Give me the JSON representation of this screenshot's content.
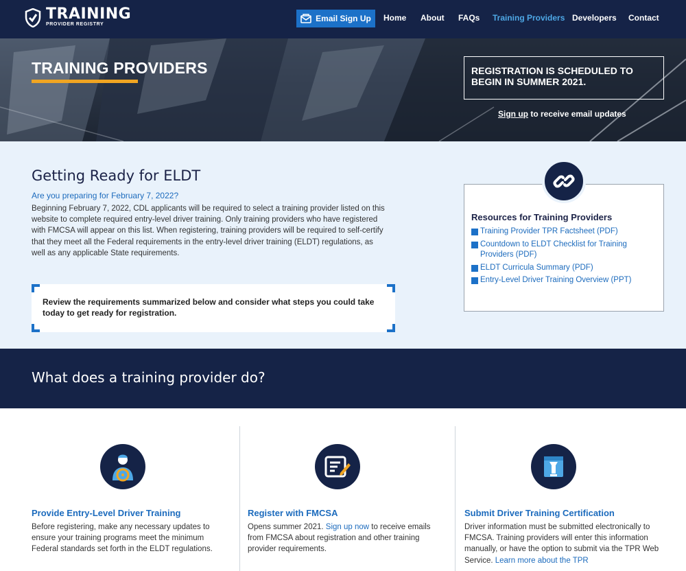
{
  "nav": {
    "logo_main": "TRAINING",
    "logo_sub": "PROVIDER REGISTRY",
    "email_button": "Email Sign Up",
    "links": [
      "Home",
      "About",
      "FAQs",
      "Training Providers",
      "Developers",
      "Contact"
    ],
    "active": "Training Providers",
    "colors": {
      "bg": "#152347",
      "active": "#4ea8e6",
      "button": "#1c71c8"
    }
  },
  "hero": {
    "title": "TRAINING PROVIDERS",
    "registration_notice": "REGISTRATION IS SCHEDULED TO BEGIN IN SUMMER 2021.",
    "signup_link": "Sign up",
    "signup_rest": " to receive email updates",
    "accent_color": "#f0a522"
  },
  "ready": {
    "heading": "Getting Ready for ELDT",
    "subheading": "Are you preparing for February 7, 2022?",
    "body": "Beginning February 7, 2022, CDL applicants will be required to select a training provider listed on this website to complete required entry-level driver training. Only training providers who have registered with FMCSA will appear on this list. When registering, training providers will be required to self-certify that they meet all the Federal requirements in the entry-level driver training (ELDT) regulations, as well as any applicable State requirements.",
    "callout": "Review the requirements summarized below and consider what steps you could take today to get ready for registration."
  },
  "resources": {
    "icon": "link-icon",
    "title": "Resources for Training Providers",
    "items": [
      "Training Provider TPR Factsheet (PDF)",
      "Countdown to ELDT Checklist for Training Providers (PDF)",
      "ELDT Curricula Summary (PDF)",
      "Entry-Level Driver Training Overview (PPT)"
    ]
  },
  "what": {
    "heading": "What does a training provider do?"
  },
  "columns": [
    {
      "icon": "driver-icon",
      "title": "Provide Entry-Level Driver Training",
      "text": "Before registering, make any necessary updates to ensure your training programs meet the minimum Federal standards set forth in the ELDT regulations."
    },
    {
      "icon": "form-edit-icon",
      "title": "Register with FMCSA",
      "text_before": "Opens summer 2021. ",
      "link": "Sign up now",
      "text_after": " to receive emails from FMCSA about registration and other training provider requirements."
    },
    {
      "icon": "inbox-tray-icon",
      "title": "Submit Driver Training Certification",
      "text_before": "Driver information must be submitted electronically to FMCSA. Training providers will enter this information manually, or have the option to submit via the TPR Web Service. ",
      "link": "Learn more about the TPR"
    }
  ]
}
